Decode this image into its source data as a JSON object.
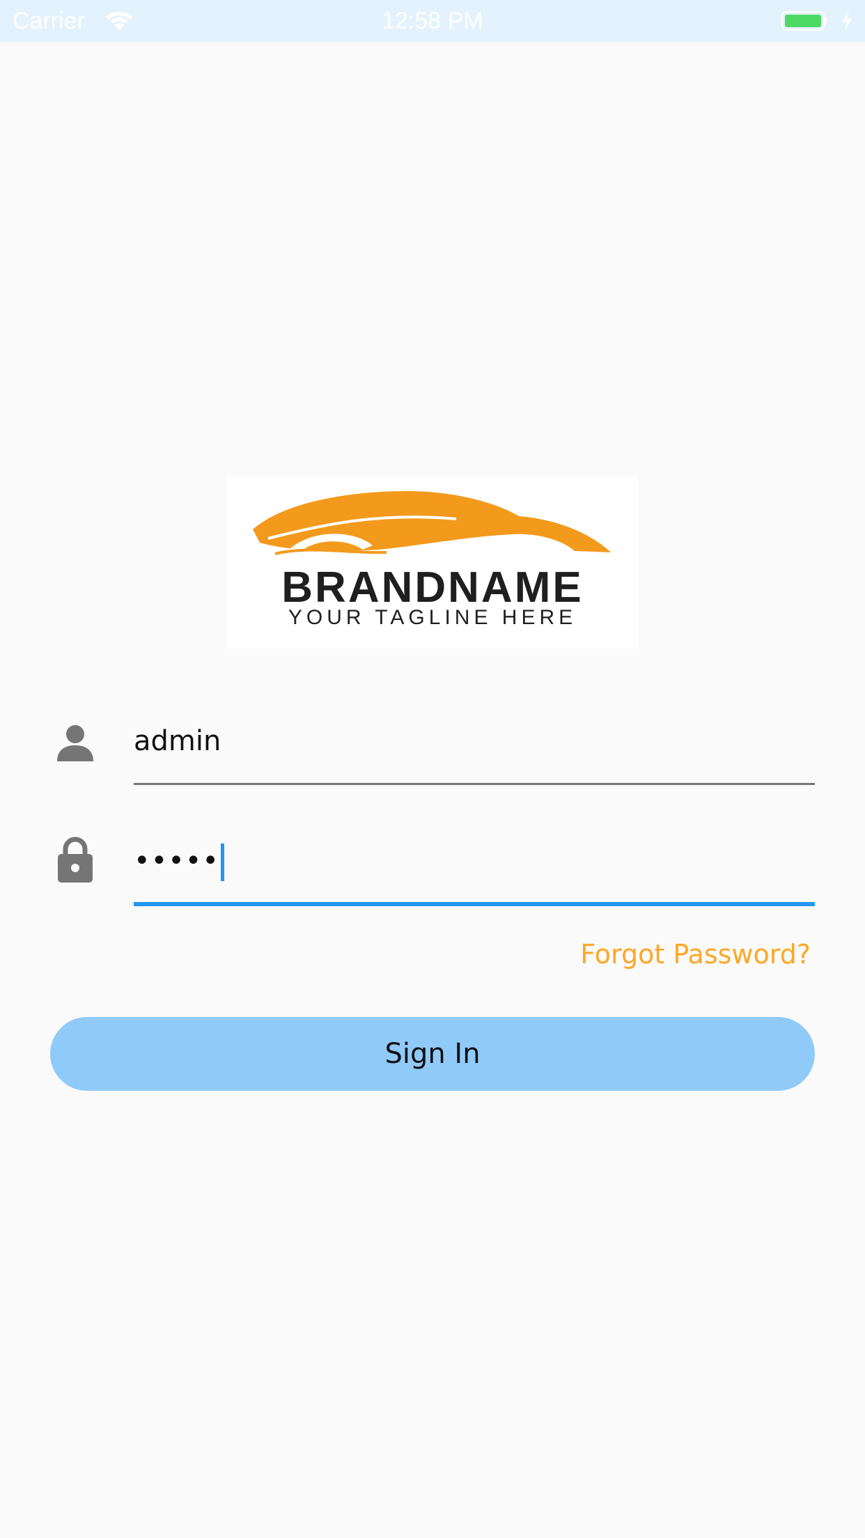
{
  "status_bar": {
    "carrier": "Carrier",
    "time": "12:58 PM",
    "wifi_icon": "wifi-icon",
    "battery_icon": "battery-icon",
    "charging_icon": "charging-bolt-icon",
    "background_color": "#e3f2fd",
    "battery_color": "#4cd964"
  },
  "logo": {
    "brand": "BRANDNAME",
    "tagline": "YOUR TAGLINE HERE",
    "accent_color": "#f39a1d"
  },
  "login_form": {
    "username": {
      "icon": "person-icon",
      "value": "admin"
    },
    "password": {
      "icon": "lock-icon",
      "masked_value": "•••••",
      "focused": true
    },
    "forgot_password_label": "Forgot Password?",
    "sign_in_label": "Sign In"
  },
  "colors": {
    "primary": "#2196f3",
    "button": "#90caf9",
    "link": "#ffa726",
    "icon": "#757575",
    "background": "#fafafa"
  }
}
